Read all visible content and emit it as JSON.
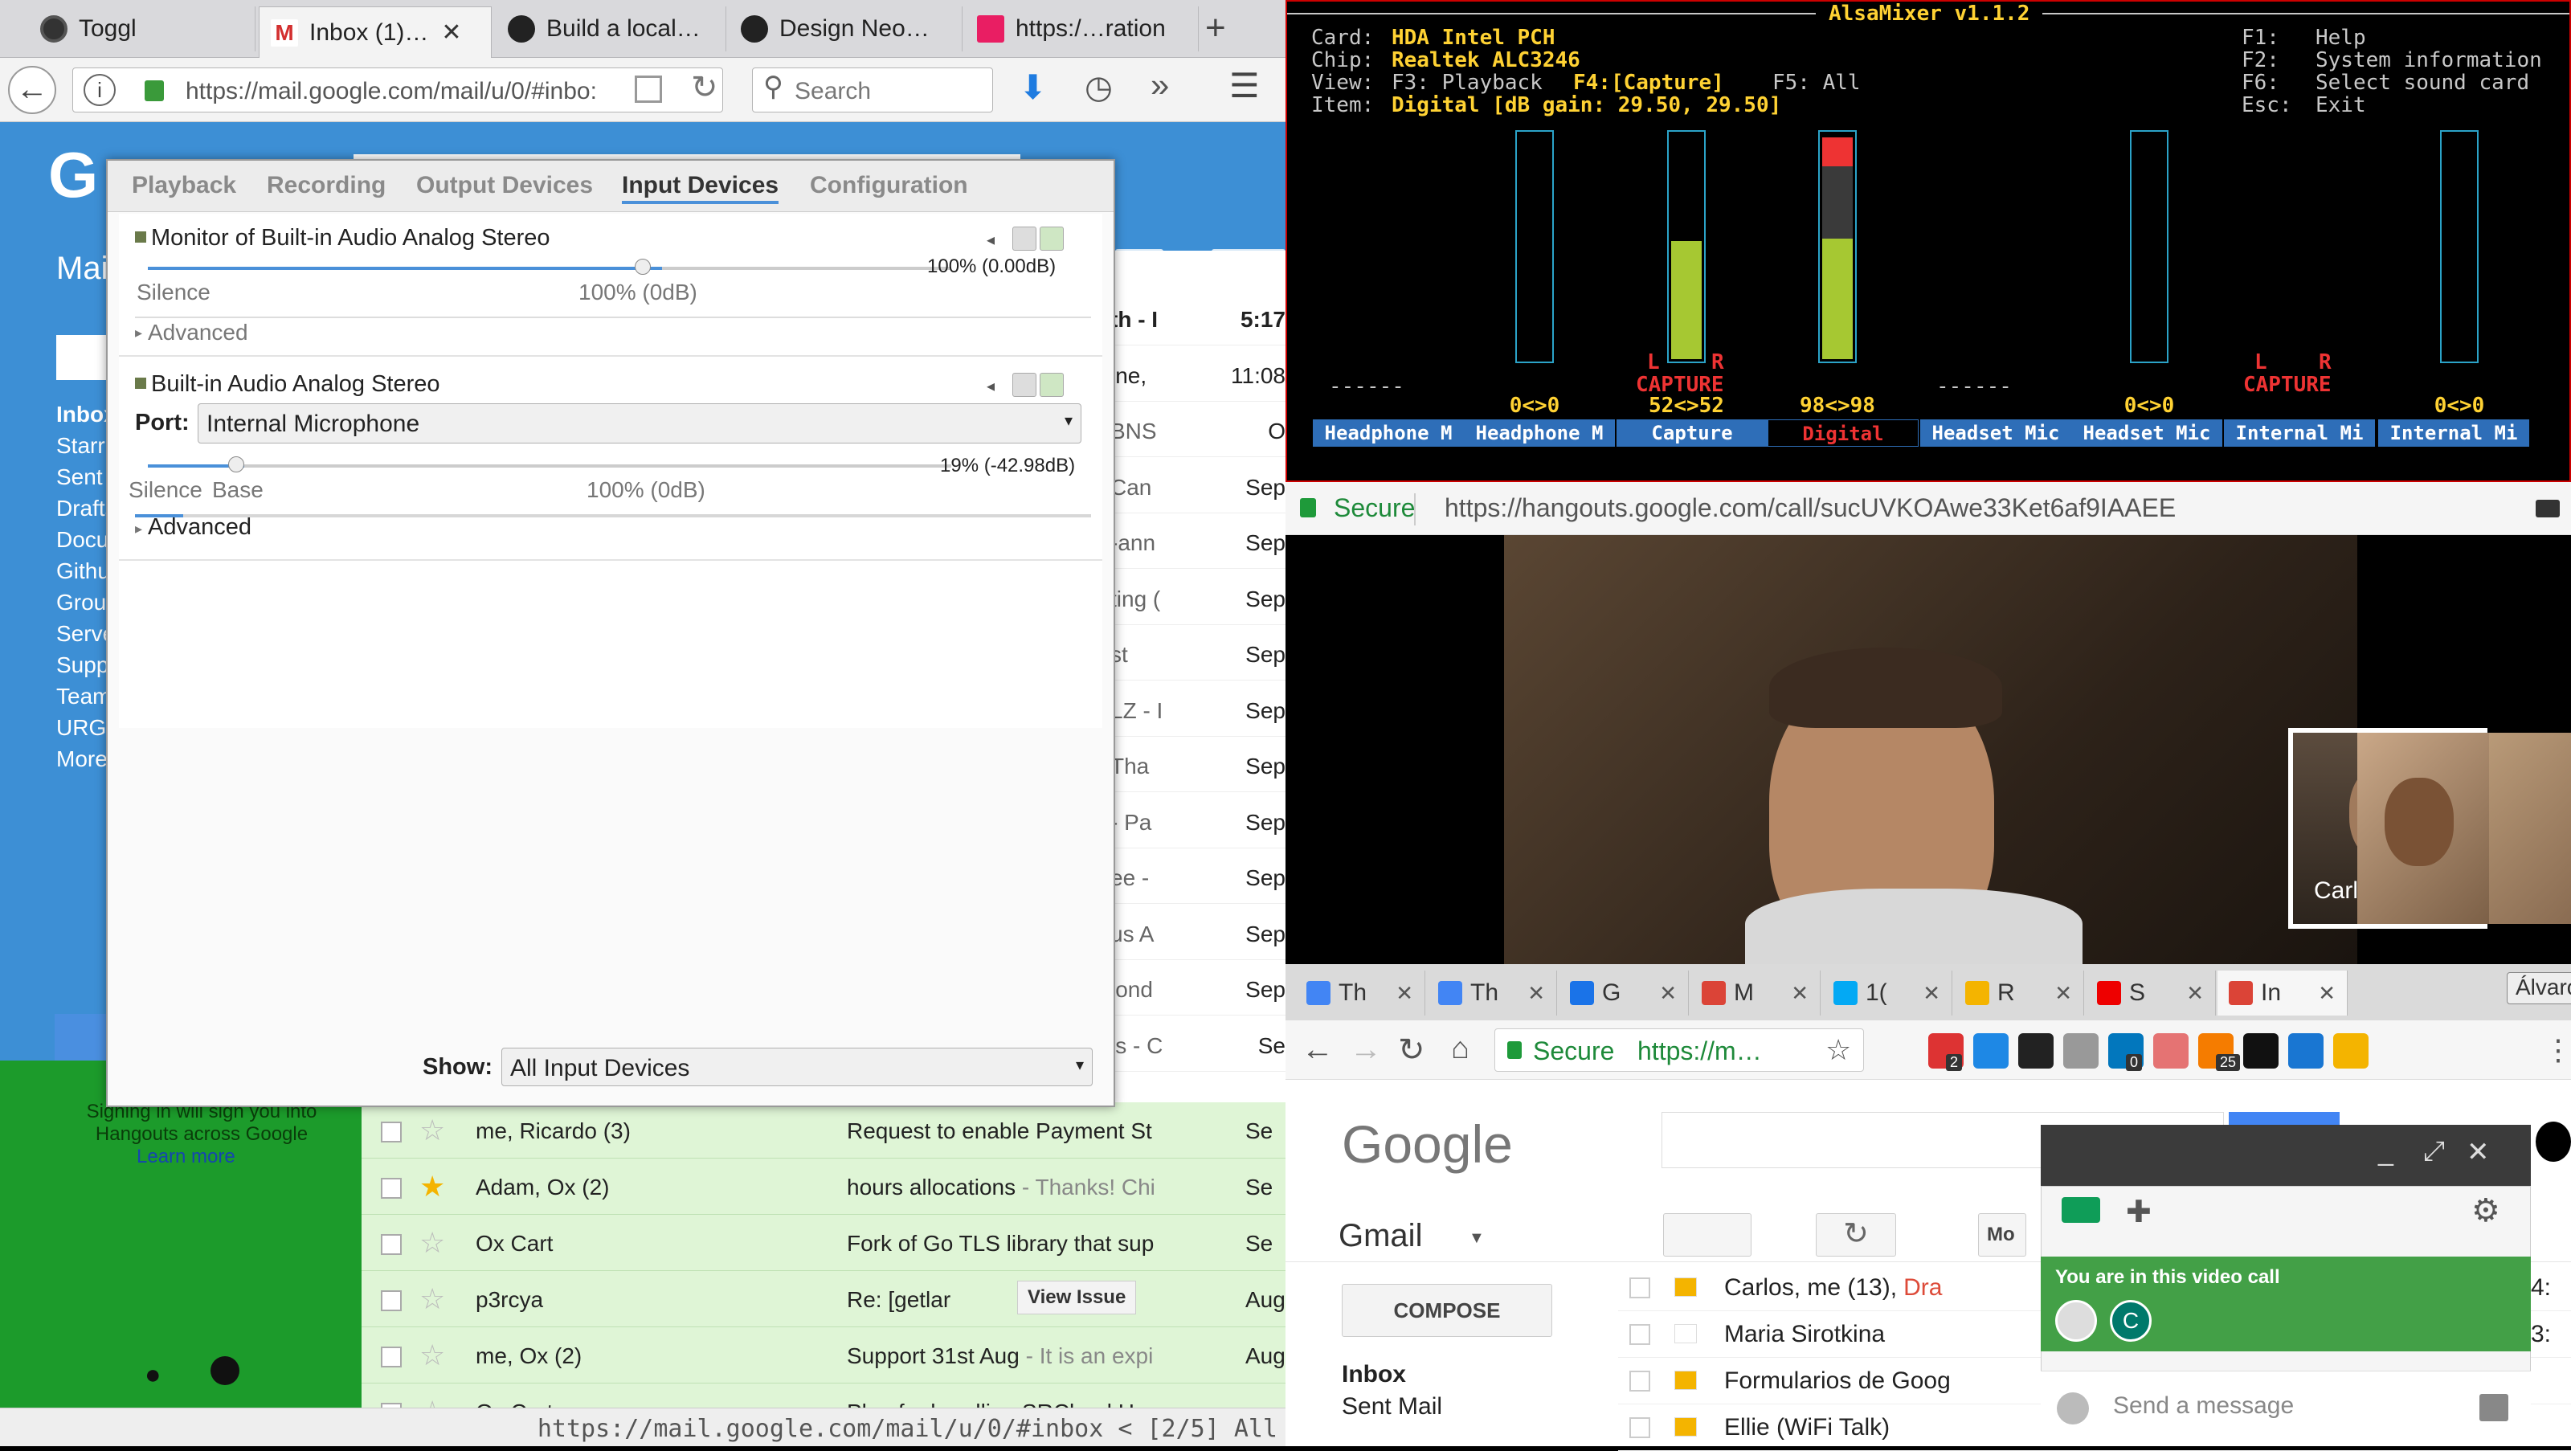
{
  "firefox": {
    "tabs": [
      {
        "title": "Toggl"
      },
      {
        "title": "Inbox (1)…"
      },
      {
        "title": "Build a local…"
      },
      {
        "title": "Design Neo…"
      },
      {
        "title": "https:/…ration"
      }
    ],
    "url": "https://mail.google.com/mail/u/0/#inbo:",
    "search_placeholder": "Search",
    "statusbar_text": "https://mail.google.com/mail/u/0/#inbox < [2/5] All",
    "gmail_partial": {
      "header_letter": "G",
      "mail_label": "Mai",
      "time_header": "5:17",
      "sidebar": [
        "Inbox",
        "Starr",
        "Sent",
        "Drafts",
        "Docu",
        "Githu",
        "Grou",
        "Serve",
        "Supp",
        "Team",
        "URG",
        "More"
      ],
      "hangouts_msg": "Signing in will sign you into Hangouts across Google",
      "hangouts_link": "Learn more",
      "right_col": [
        {
          "s": "th - I",
          "t": "5:17"
        },
        {
          "s": "ine,",
          "t": "11:08"
        },
        {
          "s": "BNS",
          "t": "O"
        },
        {
          "s": "Can",
          "t": "Sep"
        },
        {
          "s": "-ann",
          "t": "Sep"
        },
        {
          "s": "ting (",
          "t": "Sep"
        },
        {
          "s": "st",
          "t": "Sep"
        },
        {
          "s": "LZ - I",
          "t": "Sep"
        },
        {
          "s": "Tha",
          "t": "Sep"
        },
        {
          "s": "- Pa",
          "t": "Sep"
        },
        {
          "s": "ee -",
          "t": "Sep"
        },
        {
          "s": "us A",
          "t": "Sep"
        },
        {
          "s": "lond",
          "t": "Sep"
        },
        {
          "s": "ls - C",
          "t": "Se"
        }
      ],
      "rows": [
        {
          "from": "me, Ricardo (3)",
          "subject": "Request to enable Payment St",
          "date": "Se",
          "starred": false
        },
        {
          "from": "Adam, Ox (2)",
          "subject": "hours allocations",
          "snippet": " - Thanks! Chi",
          "date": "Se",
          "starred": true
        },
        {
          "from": "Ox Cart",
          "subject": "Fork of Go TLS library that sup",
          "date": "Se",
          "starred": false
        },
        {
          "from": "p3rcya",
          "subject": "Re: [getlar",
          "badge": "View Issue",
          "date": "Aug",
          "starred": false
        },
        {
          "from": "me, Ox (2)",
          "subject": "Support 31st Aug",
          "snippet": " - It is an expi",
          "date": "Aug",
          "starred": false
        },
        {
          "from": "Ox Cart",
          "subject": "Plan for handling SRCloud Hea",
          "date": "",
          "starred": false
        }
      ]
    }
  },
  "pavucontrol": {
    "tabs": [
      "Playback",
      "Recording",
      "Output Devices",
      "Input Devices",
      "Configuration"
    ],
    "active_tab": "Input Devices",
    "devices": [
      {
        "name": "Monitor of Built-in Audio Analog Stereo",
        "volume": "100% (0.00dB)",
        "level": 1.0,
        "silence": "Silence",
        "base": "100% (0dB)",
        "advanced": "Advanced"
      },
      {
        "name": "Built-in Audio Analog Stereo",
        "port_label": "Port:",
        "port": "Internal Microphone",
        "volume": "19% (-42.98dB)",
        "level": 0.19,
        "silence": "Silence",
        "silence_base": "Base",
        "base": "100% (0dB)",
        "advanced": "Advanced"
      }
    ],
    "show_label": "Show:",
    "show_value": "All Input Devices"
  },
  "alsamixer": {
    "title": "AlsaMixer v1.1.2",
    "card_label": "Card:",
    "card": "HDA Intel PCH",
    "chip_label": "Chip:",
    "chip": "Realtek ALC3246",
    "view_label": "View:",
    "view_f3": "F3: Playback",
    "view_f4": "F4:[Capture]",
    "view_f5": "F5: All",
    "item_label": "Item:",
    "item": "Digital [dB gain: 29.50, 29.50]",
    "help": [
      {
        "key": "F1:",
        "text": "Help"
      },
      {
        "key": "F2:",
        "text": "System information"
      },
      {
        "key": "F6:",
        "text": "Select sound card"
      },
      {
        "key": "Esc:",
        "text": "Exit"
      }
    ],
    "channels": [
      {
        "label": "Headphone M",
        "value": "",
        "capture": false,
        "level": 0,
        "dash": true
      },
      {
        "label": "Headphone M",
        "value": "0<>0",
        "capture": false,
        "level": 0,
        "dash": false
      },
      {
        "label": "Capture",
        "value": "52<>52",
        "capture": true,
        "level": 0.52,
        "dash": false
      },
      {
        "label": "Digital",
        "value": "98<>98",
        "capture": false,
        "level": 0.98,
        "dash": false,
        "selected": true
      },
      {
        "label": "Headset Mic",
        "value": "",
        "capture": false,
        "level": 0,
        "dash": true
      },
      {
        "label": "Headset Mic",
        "value": "0<>0",
        "capture": false,
        "level": 0,
        "dash": false
      },
      {
        "label": "Internal Mi",
        "value": "",
        "capture": true,
        "level": 0,
        "dash": false
      },
      {
        "label": "Internal Mi",
        "value": "0<>0",
        "capture": false,
        "level": 0,
        "dash": false
      }
    ],
    "capture_text": "CAPTURE",
    "l": "L",
    "r": "R",
    "dashes": "------"
  },
  "hangouts_call": {
    "secure": "Secure",
    "url": "https://hangouts.google.com/call/sucUVKOAwe33Ket6af9IAAEE",
    "participant": "Carlos"
  },
  "chrome": {
    "tabs": [
      "Th",
      "Th",
      "G",
      "M",
      "1(",
      "R",
      "S",
      "In"
    ],
    "user": "Álvaro",
    "secure": "Secure",
    "url": "https://m…",
    "gmail": {
      "logo": "Google",
      "gmail_label": "Gmail",
      "compose": "COMPOSE",
      "nav": [
        "Inbox",
        "Sent Mail"
      ],
      "more_label": "Mo",
      "rows": [
        {
          "from": "Carlos, me (13),",
          "draft": "Dra",
          "date": "4:"
        },
        {
          "from": "Maria Sirotkina",
          "draft": "",
          "date": "3:"
        },
        {
          "from": "Formularios de Goog",
          "draft": "",
          "date": ""
        },
        {
          "from": "Ellie (WiFi Talk)",
          "draft": "",
          "date": ""
        }
      ]
    },
    "hangout_panel": {
      "notice": "You are in this video call",
      "avatar_letter": "C",
      "message_placeholder": "Send a message"
    },
    "ext_badges": [
      "2",
      "0",
      "25"
    ]
  }
}
